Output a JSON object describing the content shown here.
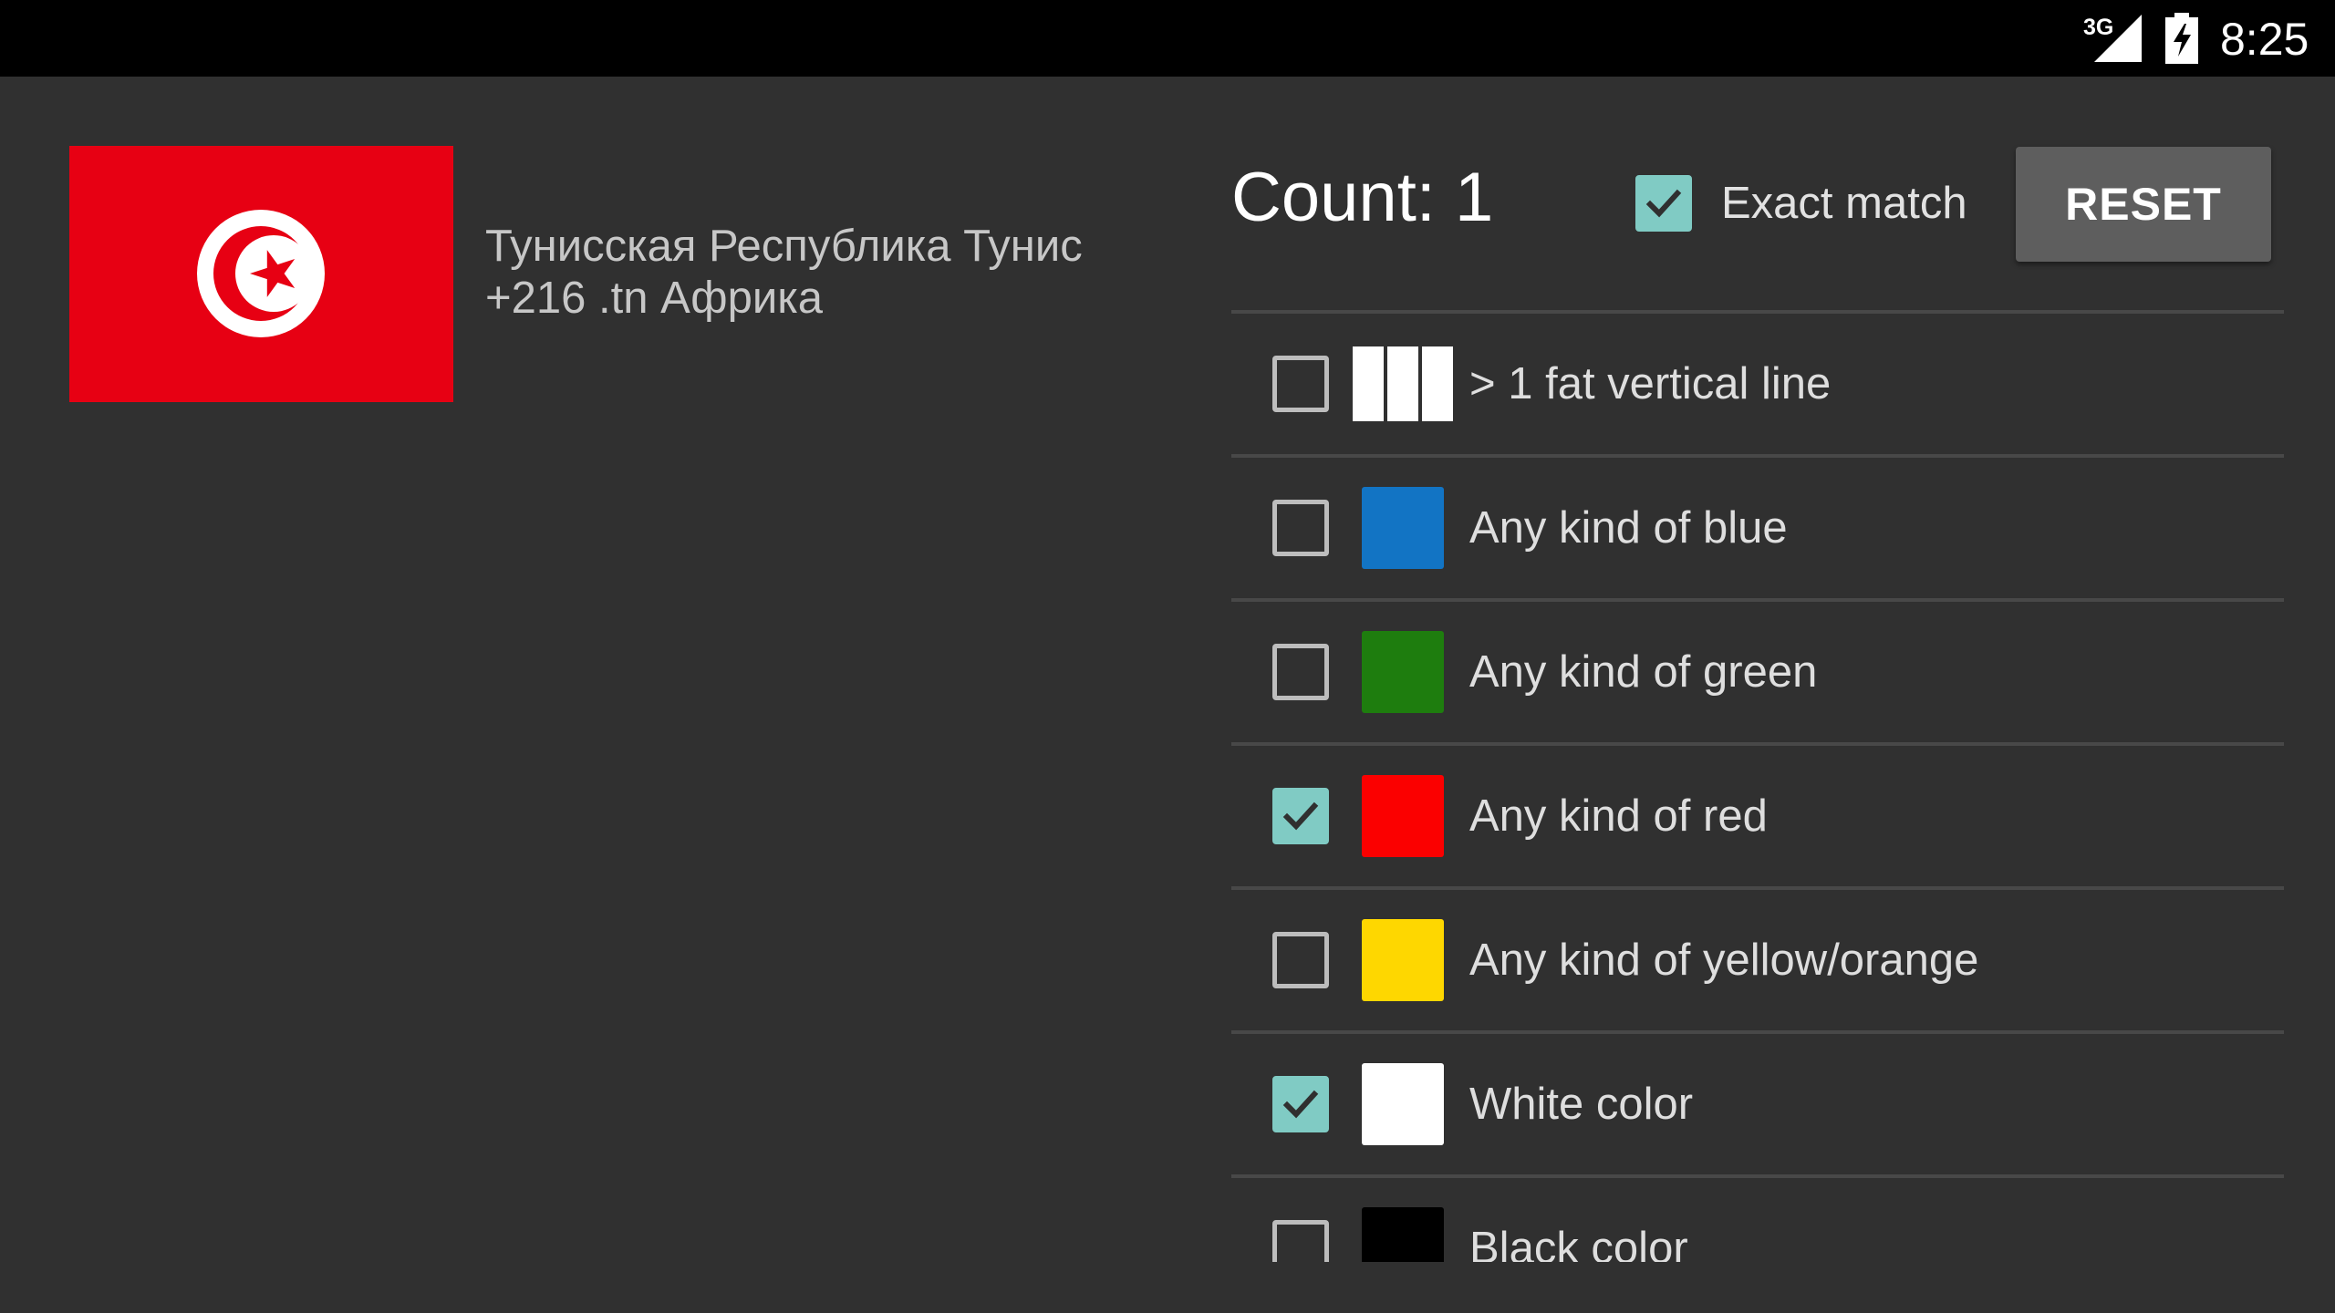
{
  "status_bar": {
    "network": "3G",
    "time": "8:25",
    "signal_icon": "signal-icon",
    "battery_icon": "battery-charging-icon"
  },
  "flag": {
    "country": "Tunisia",
    "colors": {
      "background": "#e70013",
      "emblem": "#ffffff"
    }
  },
  "country": {
    "line1": "Тунисская Республика Тунис",
    "line2": "+216 .tn Африка"
  },
  "count": {
    "label": "Count:",
    "value": "1"
  },
  "exact_match": {
    "label": "Exact match",
    "checked": true
  },
  "reset": {
    "label": "RESET"
  },
  "filters": [
    {
      "label": "> 1 fat vertical line",
      "checked": false,
      "swatch": "lines",
      "color": "#ffffff"
    },
    {
      "label": "Any kind of blue",
      "checked": false,
      "swatch": "color",
      "color": "#1274c4"
    },
    {
      "label": "Any kind of green",
      "checked": false,
      "swatch": "color",
      "color": "#1e7d0e"
    },
    {
      "label": "Any kind of red",
      "checked": true,
      "swatch": "color",
      "color": "#fb0000"
    },
    {
      "label": "Any kind of yellow/orange",
      "checked": false,
      "swatch": "color",
      "color": "#fed700"
    },
    {
      "label": "White color",
      "checked": true,
      "swatch": "color",
      "color": "#ffffff"
    },
    {
      "label": "Black color",
      "checked": false,
      "swatch": "color",
      "color": "#000000"
    }
  ],
  "accent_color": "#80cbc4"
}
